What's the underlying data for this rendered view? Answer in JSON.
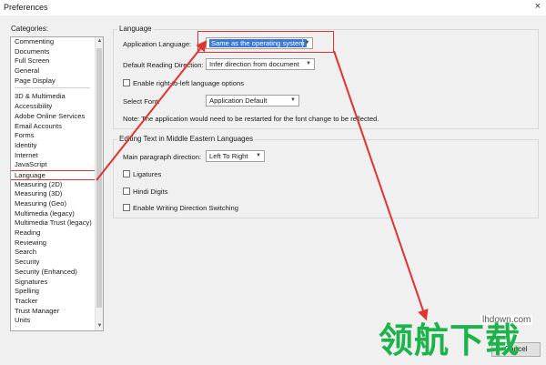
{
  "window": {
    "title": "Preferences",
    "close_glyph": "×"
  },
  "categories": {
    "label": "Categories:",
    "top_items": [
      "Commenting",
      "Documents",
      "Full Screen",
      "General",
      "Page Display"
    ],
    "items": [
      "3D & Multimedia",
      "Accessibility",
      "Adobe Online Services",
      "Email Accounts",
      "Forms",
      "Identity",
      "Internet",
      "JavaScript",
      "Language",
      "Measuring (2D)",
      "Measuring (3D)",
      "Measuring (Geo)",
      "Multimedia (legacy)",
      "Multimedia Trust (legacy)",
      "Reading",
      "Reviewing",
      "Search",
      "Security",
      "Security (Enhanced)",
      "Signatures",
      "Spelling",
      "Tracker",
      "Trust Manager",
      "Units"
    ],
    "selected": "Language"
  },
  "language": {
    "group_title": "Language",
    "app_language_label": "Application Language:",
    "app_language_value": "Same as the operating system",
    "reading_direction_label": "Default Reading Direction:",
    "reading_direction_value": "Infer direction from document",
    "rtl_label": "Enable right-to-left language options",
    "font_label": "Select Font:",
    "font_value": "Application Default",
    "note": "Note: The application would need to be restarted for the font change to be reflected."
  },
  "middle_east": {
    "group_title": "Editing Text in Middle Eastern Languages",
    "direction_label": "Main paragraph direction:",
    "direction_value": "Left To Right",
    "ligatures_label": "Ligatures",
    "hindi_label": "Hindi Digits",
    "switching_label": "Enable Writing Direction Switching"
  },
  "buttons": {
    "cancel": "Cancel"
  },
  "watermark": {
    "text": "领航下载",
    "url": "lhdown.com"
  },
  "colors": {
    "annotation_red": "#e0342f",
    "selection_blue": "#3b78d8",
    "watermark_green": "#1bb34a"
  }
}
